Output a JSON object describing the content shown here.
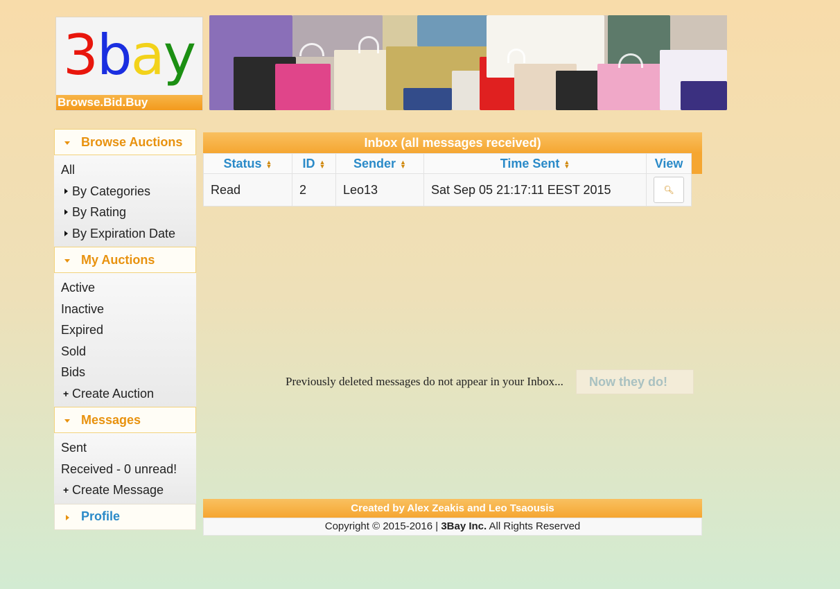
{
  "logo": {
    "letters": [
      {
        "char": "3",
        "color": "#e8160c"
      },
      {
        "char": "b",
        "color": "#1a2ee0"
      },
      {
        "char": "a",
        "color": "#f2d21a"
      },
      {
        "char": "y",
        "color": "#1b8f12"
      }
    ],
    "tagline": "Browse.Bid.Buy"
  },
  "sidebar": {
    "sections": [
      {
        "title": "Browse Auctions",
        "expanded": true,
        "items": [
          {
            "label": "All",
            "marker": "none"
          },
          {
            "label": "By Categories",
            "marker": "caret"
          },
          {
            "label": "By Rating",
            "marker": "caret"
          },
          {
            "label": "By Expiration Date",
            "marker": "caret"
          }
        ]
      },
      {
        "title": "My Auctions",
        "expanded": true,
        "items": [
          {
            "label": "Active",
            "marker": "none"
          },
          {
            "label": "Inactive",
            "marker": "none"
          },
          {
            "label": "Expired",
            "marker": "none"
          },
          {
            "label": "Sold",
            "marker": "none"
          },
          {
            "label": "Bids",
            "marker": "none"
          },
          {
            "label": "Create Auction",
            "marker": "plus"
          }
        ]
      },
      {
        "title": "Messages",
        "expanded": true,
        "items": [
          {
            "label": "Sent",
            "marker": "none"
          },
          {
            "label": "Received - 0 unread!",
            "marker": "none"
          },
          {
            "label": "Create Message",
            "marker": "plus"
          }
        ]
      },
      {
        "title": "Profile",
        "expanded": false,
        "items": []
      }
    ]
  },
  "inbox": {
    "title": "Inbox (all messages received)",
    "columns": [
      "Status",
      "ID",
      "Sender",
      "Time Sent",
      "View"
    ],
    "rows": [
      {
        "status": "Read",
        "id": "2",
        "sender": "Leo13",
        "time_sent": "Sat Sep 05 21:17:11 EEST 2015",
        "view_icon": "magnifier-icon"
      }
    ],
    "note": "Previously deleted messages do not appear in your Inbox...",
    "show_deleted_button": "Now they do!"
  },
  "footer": {
    "credits": "Created by Alex Zeakis and Leo Tsaousis",
    "copyright_prefix": "Copyright © 2015-2016 |",
    "company": "3Bay Inc.",
    "rights": "All Rights Reserved"
  },
  "colors": {
    "accent": "#f5a631",
    "section_title": "#e8920f",
    "header_link": "#2a8ac8"
  }
}
